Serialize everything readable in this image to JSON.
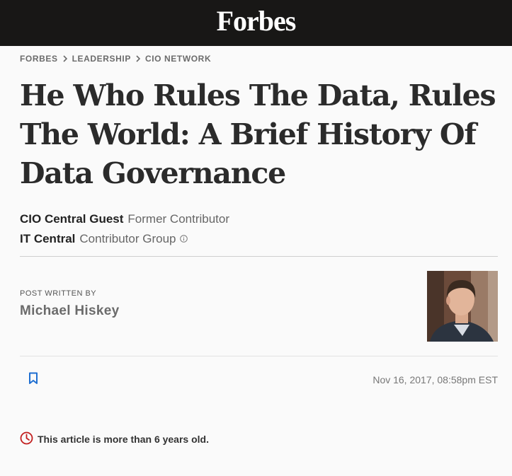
{
  "header": {
    "logo_text": "Forbes",
    "background": "#181716"
  },
  "breadcrumb": [
    "FORBES",
    "LEADERSHIP",
    "CIO NETWORK"
  ],
  "article": {
    "title": "He Who Rules The Data, Rules The World: A Brief History Of Data Governance",
    "contributors": [
      {
        "name": "CIO Central Guest",
        "role": "Former Contributor"
      },
      {
        "name": "IT Central",
        "role": "Contributor Group"
      }
    ],
    "post_written_by_label": "POST WRITTEN BY",
    "author": "Michael Hiskey",
    "date": "Nov 16, 2017, 08:58pm EST",
    "age_notice": "This article is more than 6 years old."
  },
  "icons": {
    "breadcrumb_separator": "chevron-right-icon",
    "contributor_info": "info-icon",
    "bookmark": "bookmark-icon",
    "age_notice": "clock-icon"
  },
  "colors": {
    "accent_blue": "#1f6fd1",
    "alert_red": "#c21f1f"
  }
}
